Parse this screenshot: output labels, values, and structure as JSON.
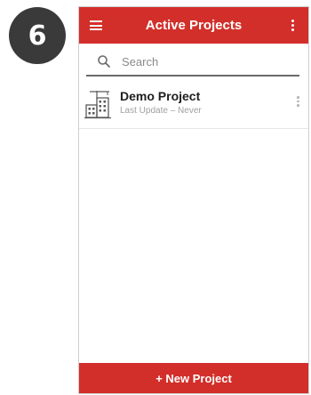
{
  "step_badge": "6",
  "app_bar": {
    "title": "Active Projects",
    "menu_icon": "hamburger-menu-icon",
    "overflow_icon": "more-vert-icon",
    "color": "#d22f2a"
  },
  "search": {
    "placeholder": "Search",
    "icon": "search-icon"
  },
  "projects": [
    {
      "name": "Demo Project",
      "subtitle": "Last Update – Never",
      "icon": "building-icon",
      "menu_icon": "more-vert-icon"
    }
  ],
  "footer": {
    "new_project_label": "+ New Project",
    "color": "#d22f2a"
  }
}
